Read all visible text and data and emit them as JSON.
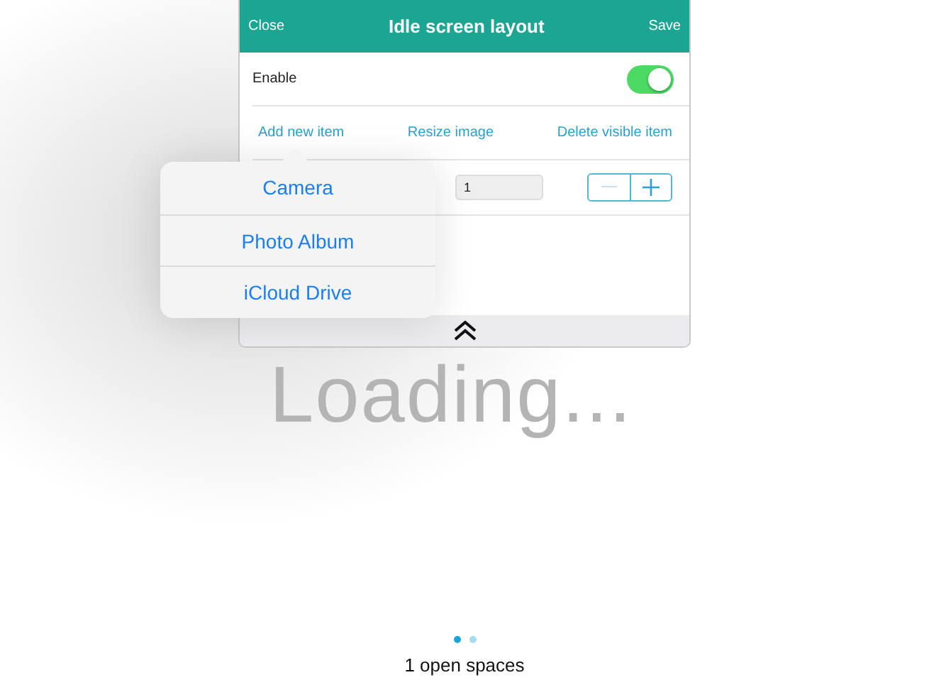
{
  "background_text": "Loading...",
  "dialog": {
    "close": "Close",
    "title": "Idle screen layout",
    "save": "Save",
    "enable": {
      "label": "Enable",
      "on": true
    },
    "actions": [
      "Add new item",
      "Resize image",
      "Delete visible item"
    ],
    "count_field": {
      "value": "1"
    },
    "stepper": {
      "decrement_disabled": true,
      "increment_disabled": false
    }
  },
  "popover": {
    "items": [
      "Camera",
      "Photo Album",
      "iCloud Drive"
    ]
  },
  "page_dots": [
    {
      "selected": true
    },
    {
      "selected": false
    }
  ],
  "footer": "1 open spaces"
}
